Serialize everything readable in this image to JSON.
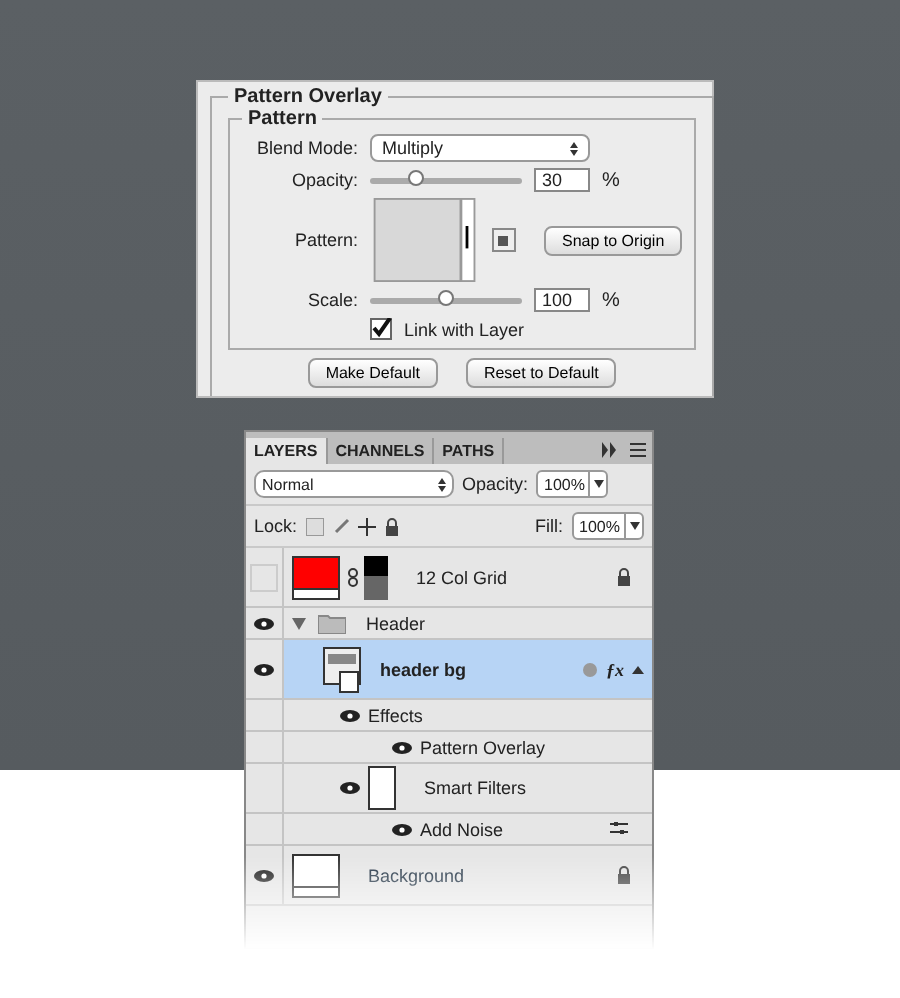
{
  "dialog": {
    "title": "Pattern Overlay",
    "section": "Pattern",
    "blend_mode": {
      "label": "Blend Mode:",
      "value": "Multiply"
    },
    "opacity": {
      "label": "Opacity:",
      "value": "30",
      "unit": "%",
      "level": 0.3
    },
    "pattern": {
      "label": "Pattern:",
      "snap_button": "Snap to Origin"
    },
    "scale": {
      "label": "Scale:",
      "value": "100",
      "unit": "%",
      "level": 0.5
    },
    "link": {
      "label": "Link with Layer",
      "checked": true
    },
    "buttons": [
      "Make Default",
      "Reset to Default"
    ]
  },
  "layers_panel": {
    "tabs": [
      {
        "label": "LAYERS",
        "selected": true
      },
      {
        "label": "CHANNELS",
        "selected": false
      },
      {
        "label": "PATHS",
        "selected": false
      }
    ],
    "blend_mode": "Normal",
    "opacity": {
      "label": "Opacity:",
      "value": "100%"
    },
    "lock_label": "Lock:",
    "fill": {
      "label": "Fill:",
      "value": "100%"
    },
    "layers": [
      {
        "kind": "layer",
        "name": "12 Col Grid",
        "visible": false,
        "selected": false,
        "locked": true,
        "color": "#ff0000"
      },
      {
        "kind": "group",
        "name": "Header",
        "visible": true,
        "selected": false,
        "expanded": true,
        "children": [
          {
            "kind": "smart",
            "name": "header bg",
            "fx": "ƒx",
            "visible": true,
            "selected": true,
            "children": [
              {
                "kind": "effects",
                "name": "Effects",
                "visible": true,
                "children": [
                  {
                    "kind": "effect",
                    "name": "Pattern Overlay",
                    "visible": true
                  }
                ]
              },
              {
                "kind": "filters",
                "name": "Smart Filters",
                "visible": true,
                "children": [
                  {
                    "kind": "filter",
                    "name": "Add Noise",
                    "visible": true
                  }
                ]
              }
            ]
          }
        ]
      },
      {
        "kind": "layer",
        "name": "Background",
        "visible": true,
        "selected": false,
        "locked": true,
        "color": "#ffffff"
      }
    ]
  }
}
